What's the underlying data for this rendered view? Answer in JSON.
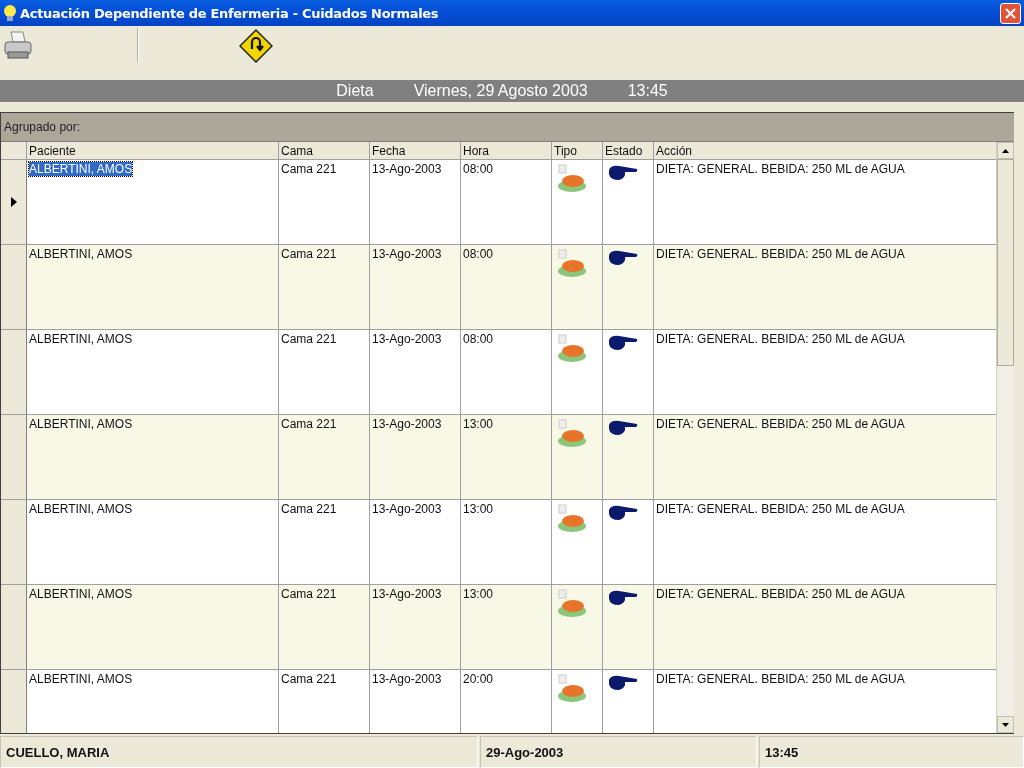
{
  "window": {
    "title": "Actuación Dependiente de Enfermeria - Cuidados Normales"
  },
  "header": {
    "section": "Dieta",
    "date": "Viernes, 29 Agosto 2003",
    "time": "13:45"
  },
  "grid": {
    "group_by_label": "Agrupado por:",
    "columns": [
      "Paciente",
      "Cama",
      "Fecha",
      "Hora",
      "Tipo",
      "Estado",
      "Acción"
    ],
    "rows": [
      {
        "paciente": "ALBERTINI, AMOS",
        "cama": "Cama 221",
        "fecha": "13-Ago-2003",
        "hora": "08:00",
        "accion": "DIETA:  GENERAL.  BEBIDA:  250  ML de AGUA",
        "selected": true
      },
      {
        "paciente": "ALBERTINI, AMOS",
        "cama": "Cama 221",
        "fecha": "13-Ago-2003",
        "hora": "08:00",
        "accion": "DIETA:  GENERAL.  BEBIDA:  250  ML de AGUA",
        "selected": false
      },
      {
        "paciente": "ALBERTINI, AMOS",
        "cama": "Cama 221",
        "fecha": "13-Ago-2003",
        "hora": "08:00",
        "accion": "DIETA:  GENERAL.  BEBIDA:  250  ML de AGUA",
        "selected": false
      },
      {
        "paciente": "ALBERTINI, AMOS",
        "cama": "Cama 221",
        "fecha": "13-Ago-2003",
        "hora": "13:00",
        "accion": "DIETA:  GENERAL.  BEBIDA:  250  ML de AGUA",
        "selected": false
      },
      {
        "paciente": "ALBERTINI, AMOS",
        "cama": "Cama 221",
        "fecha": "13-Ago-2003",
        "hora": "13:00",
        "accion": "DIETA:  GENERAL.  BEBIDA:  250  ML de AGUA",
        "selected": false
      },
      {
        "paciente": "ALBERTINI, AMOS",
        "cama": "Cama 221",
        "fecha": "13-Ago-2003",
        "hora": "13:00",
        "accion": "DIETA:  GENERAL.  BEBIDA:  250  ML de AGUA",
        "selected": false
      },
      {
        "paciente": "ALBERTINI, AMOS",
        "cama": "Cama 221",
        "fecha": "13-Ago-2003",
        "hora": "20:00",
        "accion": "DIETA:  GENERAL.  BEBIDA:  250  ML de AGUA",
        "selected": false
      }
    ]
  },
  "status_bar": [
    "CUELLO, MARIA",
    "29-Ago-2003",
    "13:45"
  ]
}
